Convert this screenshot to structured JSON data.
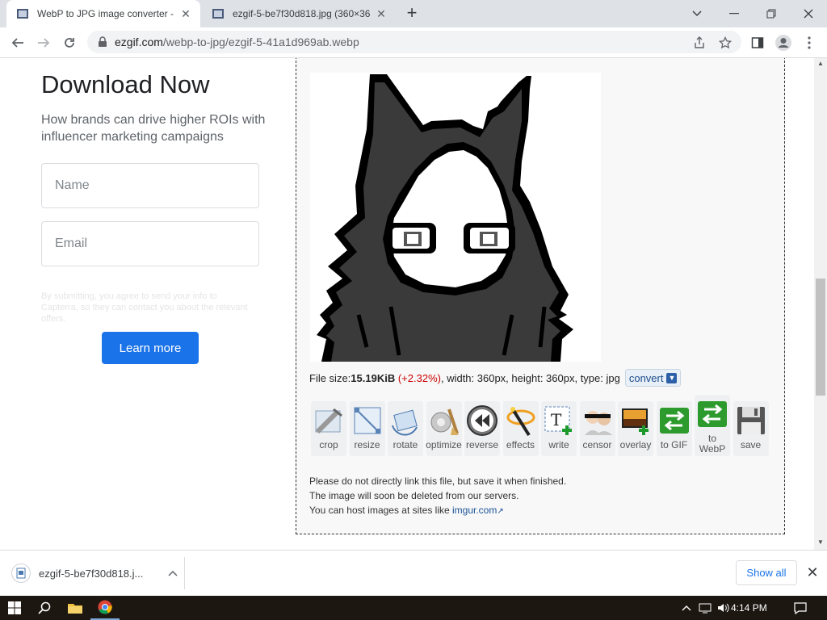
{
  "browser": {
    "tabs": [
      {
        "title": "WebP to JPG image converter - P",
        "active": true
      },
      {
        "title": "ezgif-5-be7f30d818.jpg (360×36",
        "active": false
      }
    ],
    "url_host": "ezgif.com",
    "url_path": "/webp-to-jpg/ezgif-5-41a1d969ab.webp"
  },
  "ad": {
    "title": "Download Now",
    "subtitle": "How brands can drive higher ROIs with influencer marketing campaigns",
    "name_placeholder": "Name",
    "email_placeholder": "Email",
    "legal": "By submitting, you agree to send your info to Capterra, so they can contact you about the relevant offers.",
    "button": "Learn more"
  },
  "output": {
    "file_size_label": "File size: ",
    "file_size": "15.19KiB",
    "size_change": "(+2.32%)",
    "details": ", width: 360px, height: 360px, type: jpg",
    "convert_label": "convert",
    "tools": [
      {
        "label": "crop",
        "icon": "crop-icon"
      },
      {
        "label": "resize",
        "icon": "resize-icon"
      },
      {
        "label": "rotate",
        "icon": "rotate-icon"
      },
      {
        "label": "optimize",
        "icon": "optimize-icon"
      },
      {
        "label": "reverse",
        "icon": "reverse-icon"
      },
      {
        "label": "effects",
        "icon": "effects-icon"
      },
      {
        "label": "write",
        "icon": "write-icon"
      },
      {
        "label": "censor",
        "icon": "censor-icon"
      },
      {
        "label": "overlay",
        "icon": "overlay-icon"
      },
      {
        "label": "to GIF",
        "icon": "to-gif-icon"
      },
      {
        "label": "to WebP",
        "icon": "to-webp-icon"
      },
      {
        "label": "save",
        "icon": "save-icon"
      }
    ],
    "note1": "Please do not directly link this file, but save it when finished.",
    "note2": "The image will soon be deleted from our servers.",
    "note3_prefix": "You can host images at sites like ",
    "note3_link": "imgur.com"
  },
  "downloads": {
    "filename": "ezgif-5-be7f30d818.j...",
    "show_all": "Show all"
  },
  "taskbar": {
    "time": "4:14 PM"
  },
  "colors": {
    "accent": "#1a73e8",
    "panel_border": "#333333",
    "size_change": "#cc0000"
  }
}
